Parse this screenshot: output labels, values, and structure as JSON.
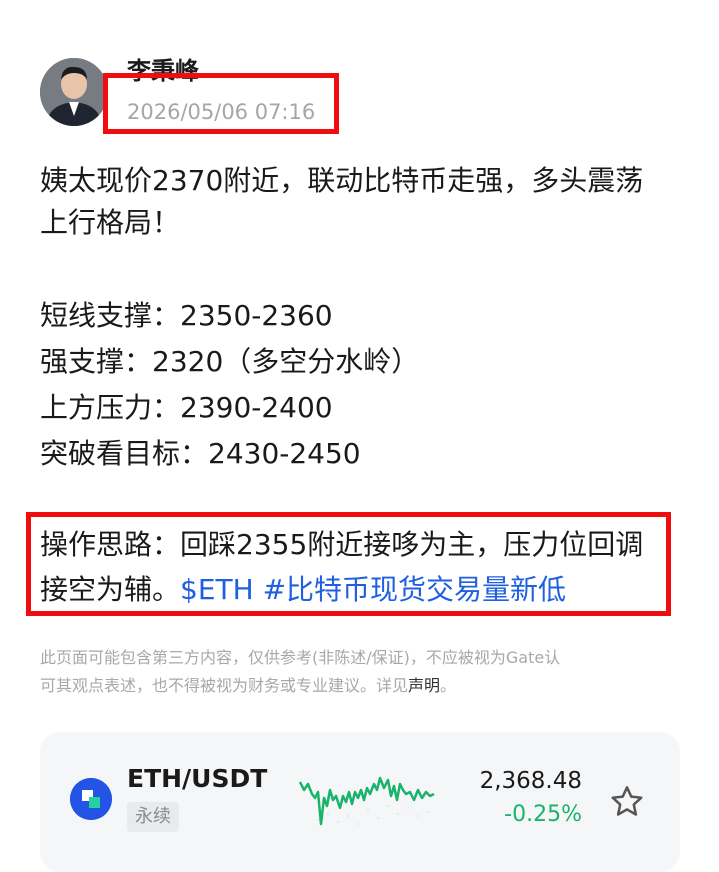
{
  "post": {
    "author_name": "李秉峰",
    "timestamp": "2026/05/06 07:16",
    "paragraph1_line1": "姨太现价2370附近，联动比特币走强，多头震荡",
    "paragraph1_line2": "上行格局！",
    "levels": [
      "短线支撑：2350-2360",
      "强支撑：2320（多空分水岭）",
      "上方压力：2390-2400",
      "突破看目标：2430-2450"
    ],
    "strategy_line1": "操作思路：回踩2355附近接哆为主，压力位回调",
    "strategy_line2_prefix": "接空为辅。",
    "tag_eth": "$ETH",
    "tag_topic": "#比特币现货交易量新低"
  },
  "disclaimer": {
    "text_line1": "此页面可能包含第三方内容，仅供参考(非陈述/保证)，不应被视为Gate认",
    "text_line2_prefix": "可其观点表述，也不得被视为财务或专业建议。详见",
    "link": "声明",
    "suffix": "。"
  },
  "ticker": {
    "pair": "ETH/USDT",
    "badge": "永续",
    "price": "2,368.48",
    "change": "-0.25%",
    "change_color": "#19b36b",
    "icon": "eth-coin-icon"
  },
  "colors": {
    "highlight_box": "#f00d0d",
    "link": "#1f5fe0"
  }
}
